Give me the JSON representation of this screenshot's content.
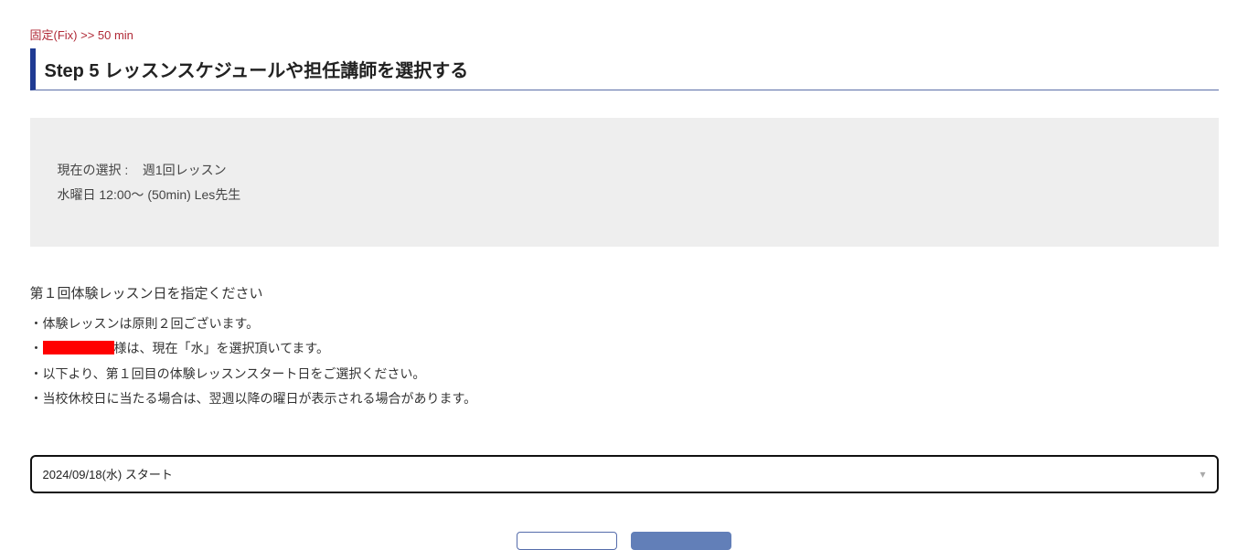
{
  "breadcrumb": {
    "label": "固定(Fix) >> 50 min"
  },
  "step": {
    "title": "Step 5 レッスンスケジュールや担任講師を選択する"
  },
  "selection": {
    "label": "現在の選択 :",
    "frequency": "週1回レッスン",
    "slot": "水曜日 12:00～ (50min) Les先生"
  },
  "instruction": {
    "title": "第１回体験レッスン日を指定ください"
  },
  "notes": {
    "n1": "体験レッスンは原則２回ございます。",
    "n2_suffix": "様は、現在「水」を選択頂いてます。",
    "n3": "以下より、第１回目の体験レッスンスタート日をご選択ください。",
    "n4": "当校休校日に当たる場合は、翌週以降の曜日が表示される場合があります。"
  },
  "date_select": {
    "value": "2024/09/18(水) スタート"
  }
}
